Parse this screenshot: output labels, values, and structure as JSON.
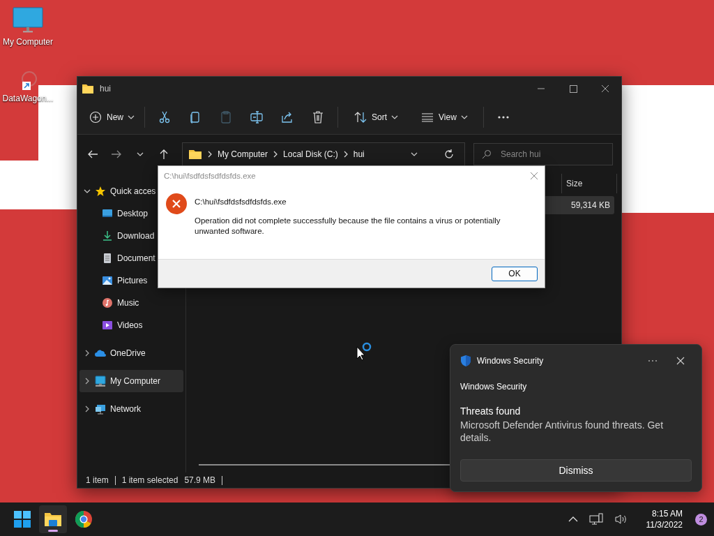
{
  "desktop_icons": [
    {
      "label": "My Computer",
      "kind": "computer"
    },
    {
      "label": "DataWagon...",
      "kind": "shortcut"
    }
  ],
  "explorer": {
    "title": "hui",
    "toolbar": [
      {
        "kind": "new",
        "label": "New",
        "disabled": false
      },
      {
        "kind": "cut",
        "disabled": false
      },
      {
        "kind": "copy",
        "disabled": false
      },
      {
        "kind": "paste",
        "disabled": true
      },
      {
        "kind": "rename",
        "disabled": false
      },
      {
        "kind": "share",
        "disabled": false
      },
      {
        "kind": "delete",
        "disabled": false
      },
      {
        "kind": "sort",
        "label": "Sort",
        "disabled": false
      },
      {
        "kind": "view",
        "label": "View",
        "disabled": false
      },
      {
        "kind": "more",
        "disabled": false
      }
    ],
    "breadcrumb": [
      "My Computer",
      "Local Disk (C:)",
      "hui"
    ],
    "search": {
      "placeholder": "Search hui"
    },
    "sidebar": [
      {
        "label": "Quick acces",
        "kind": "quick",
        "expanded": true,
        "selected": false,
        "children": [
          {
            "label": "Desktop",
            "kind": "desktop",
            "selected": false
          },
          {
            "label": "Download",
            "kind": "downloads",
            "selected": false
          },
          {
            "label": "Document",
            "kind": "documents",
            "selected": false
          },
          {
            "label": "Pictures",
            "kind": "pictures",
            "selected": false
          },
          {
            "label": "Music",
            "kind": "music",
            "selected": false
          },
          {
            "label": "Videos",
            "kind": "videos",
            "selected": false
          }
        ]
      },
      {
        "label": "OneDrive",
        "kind": "onedrive",
        "expanded": false,
        "selected": false
      },
      {
        "label": "My Computer",
        "kind": "computer",
        "expanded": false,
        "selected": true
      },
      {
        "label": "Network",
        "kind": "network",
        "expanded": false,
        "selected": false
      }
    ],
    "table": {
      "columns": [
        "Size"
      ],
      "rows": [
        {
          "size": "59,314 KB",
          "selected": true
        }
      ]
    },
    "status_bar": {
      "count": "1 item",
      "selection": "1 item selected",
      "size": "57.9 MB"
    }
  },
  "dialog": {
    "title": "C:\\hui\\fsdfdsfsdfdsfds.exe",
    "heading": "C:\\hui\\fsdfdsfsdfdsfds.exe",
    "message": "Operation did not complete successfully because the file contains a virus or potentially unwanted software.",
    "button": "OK"
  },
  "toast": {
    "app": "Windows Security",
    "source": "Windows Security",
    "title": "Threats found",
    "body": "Microsoft Defender Antivirus found threats. Get details.",
    "button": "Dismiss"
  },
  "taskbar": {
    "apps": [
      {
        "kind": "start",
        "active": false
      },
      {
        "kind": "explorer",
        "active": true
      },
      {
        "kind": "chrome",
        "active": false
      }
    ],
    "time": "8:15 AM",
    "date": "11/3/2022",
    "badge": "2"
  }
}
